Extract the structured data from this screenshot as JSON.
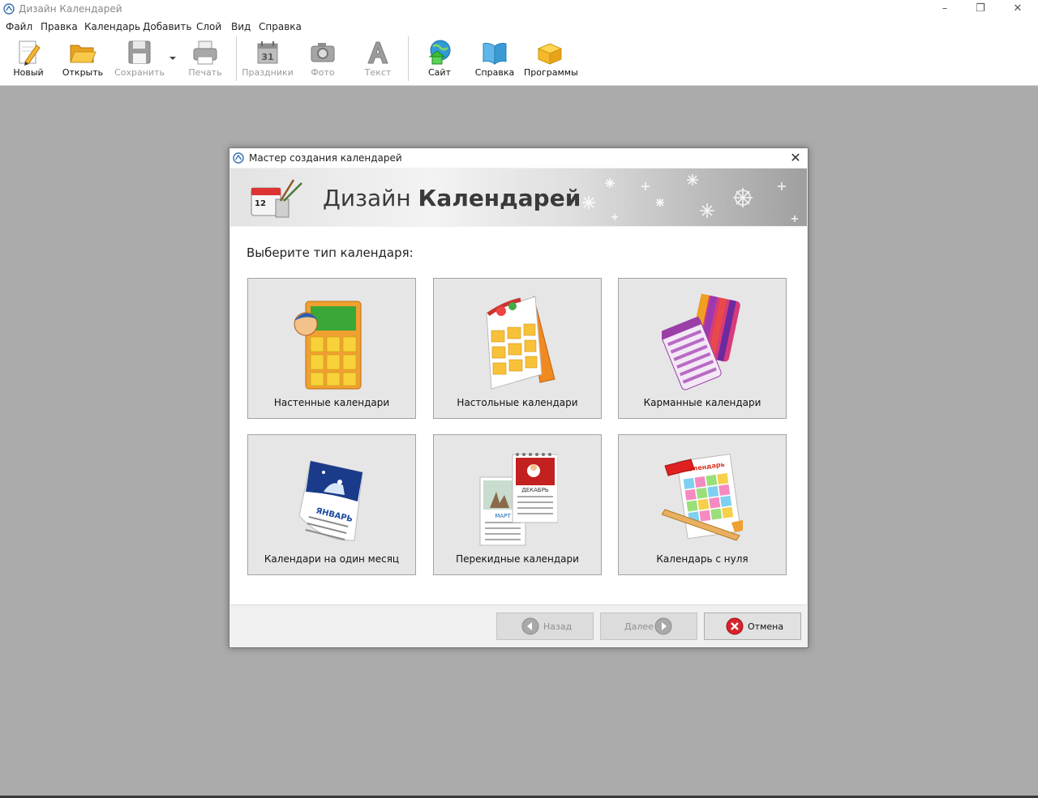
{
  "window": {
    "title": "Дизайн Календарей",
    "minimize": "–",
    "restore": "❐",
    "close": "✕"
  },
  "menu": [
    "Файл",
    "Правка",
    "Календарь",
    "Добавить",
    "Слой",
    "Вид",
    "Справка"
  ],
  "toolbar": {
    "new": "Новый",
    "open": "Открыть",
    "save": "Сохранить",
    "print": "Печать",
    "holidays": "Праздники",
    "photo": "Фото",
    "text": "Текст",
    "site": "Сайт",
    "help": "Справка",
    "programs": "Программы"
  },
  "dialog": {
    "title": "Мастер создания календарей",
    "close": "✕",
    "brand_light": "Дизайн ",
    "brand_bold": "Календарей",
    "prompt": "Выберите тип календаря:",
    "cards": [
      "Настенные календари",
      "Настольные календари",
      "Карманные календари",
      "Календари на один месяц",
      "Перекидные календари",
      "Календарь с нуля"
    ],
    "back": "Назад",
    "next": "Далее",
    "cancel": "Отмена"
  },
  "colors": {
    "workspace": "#ababab",
    "accent_orange": "#f0a030",
    "accent_purple": "#9b3ea8",
    "cancel_red": "#d8232a"
  }
}
